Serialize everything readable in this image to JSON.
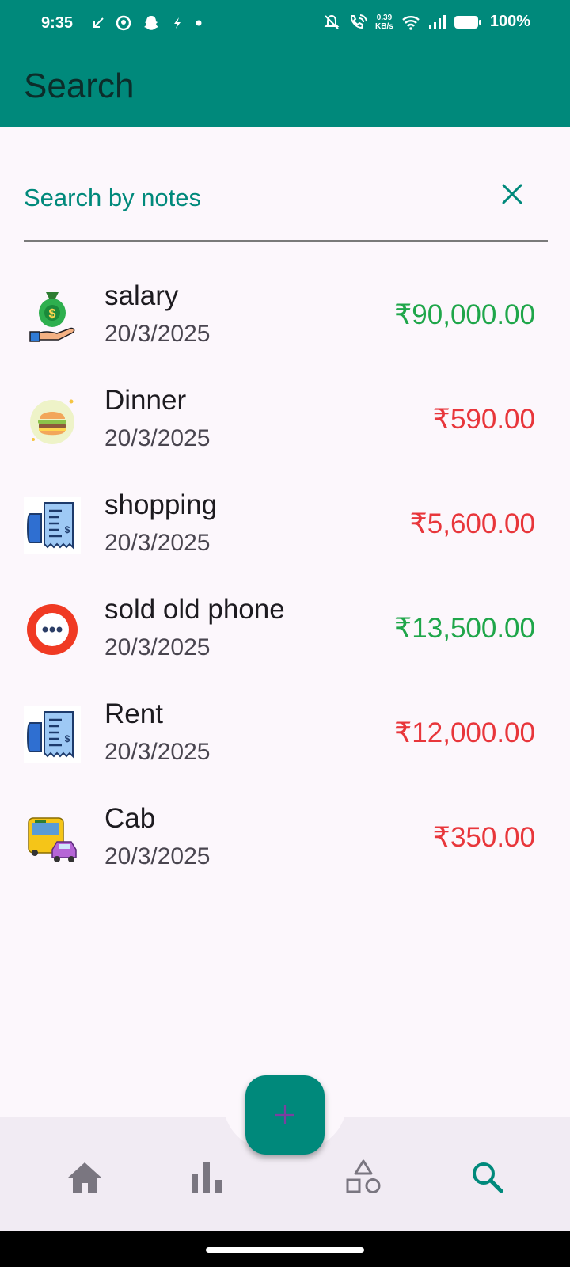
{
  "status_bar": {
    "time": "9:35",
    "net_speed_value": "0.39",
    "net_speed_unit": "KB/s",
    "battery": "100%"
  },
  "header": {
    "title": "Search"
  },
  "search": {
    "placeholder": "Search by notes",
    "value": ""
  },
  "colors": {
    "primary": "#00897b",
    "income": "#1fa64a",
    "expense": "#e8363b",
    "background": "#fcf7fc"
  },
  "transactions": [
    {
      "note": "salary",
      "date": "20/3/2025",
      "amount": "₹90,000.00",
      "type": "income",
      "icon": "money-bag-icon"
    },
    {
      "note": "Dinner",
      "date": "20/3/2025",
      "amount": "₹590.00",
      "type": "expense",
      "icon": "burger-icon"
    },
    {
      "note": "shopping",
      "date": "20/3/2025",
      "amount": "₹5,600.00",
      "type": "expense",
      "icon": "receipt-icon"
    },
    {
      "note": "sold old phone",
      "date": "20/3/2025",
      "amount": "₹13,500.00",
      "type": "income",
      "icon": "more-icon"
    },
    {
      "note": "Rent",
      "date": "20/3/2025",
      "amount": "₹12,000.00",
      "type": "expense",
      "icon": "receipt-icon"
    },
    {
      "note": "Cab",
      "date": "20/3/2025",
      "amount": "₹350.00",
      "type": "expense",
      "icon": "taxi-icon"
    }
  ],
  "bottom_nav": {
    "items": [
      "home-icon",
      "stats-icon",
      "categories-icon",
      "search-icon"
    ],
    "active": "search-icon"
  }
}
